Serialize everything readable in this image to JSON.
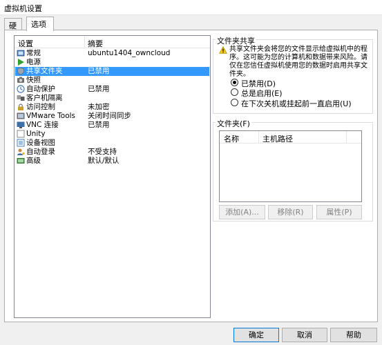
{
  "window": {
    "title": "虚拟机设置"
  },
  "tabs": [
    {
      "label": "硬件",
      "active": false
    },
    {
      "label": "选项",
      "active": true
    }
  ],
  "settings_list": {
    "headers": {
      "setting": "设置",
      "summary": "摘要"
    },
    "rows": [
      {
        "name": "常规",
        "value": "ubuntu1404_owncloud",
        "icon": "general-icon",
        "selected": false
      },
      {
        "name": "电源",
        "value": "",
        "icon": "power-play-icon",
        "selected": false
      },
      {
        "name": "共享文件夹",
        "value": "已禁用",
        "icon": "shared-folder-icon",
        "selected": true
      },
      {
        "name": "快照",
        "value": "",
        "icon": "snapshot-icon",
        "selected": false
      },
      {
        "name": "自动保护",
        "value": "已禁用",
        "icon": "autoprotect-icon",
        "selected": false
      },
      {
        "name": "客户机隔离",
        "value": "",
        "icon": "guest-isolation-icon",
        "selected": false
      },
      {
        "name": "访问控制",
        "value": "未加密",
        "icon": "access-control-icon",
        "selected": false
      },
      {
        "name": "VMware Tools",
        "value": "关闭时间同步",
        "icon": "vmware-tools-icon",
        "selected": false
      },
      {
        "name": "VNC 连接",
        "value": "已禁用",
        "icon": "vnc-icon",
        "selected": false
      },
      {
        "name": "Unity",
        "value": "",
        "icon": "unity-icon",
        "selected": false
      },
      {
        "name": "设备视图",
        "value": "",
        "icon": "device-view-icon",
        "selected": false
      },
      {
        "name": "自动登录",
        "value": "不受支持",
        "icon": "autologin-icon",
        "selected": false
      },
      {
        "name": "高级",
        "value": "默认/默认",
        "icon": "advanced-icon",
        "selected": false
      }
    ]
  },
  "folder_sharing": {
    "label": "文件夹共享",
    "warning": "共享文件夹会将您的文件显示给虚拟机中的程序。这可能为您的计算机和数据带来风险。请仅在您信任虚拟机使用您的数据时启用共享文件夹。",
    "options": [
      {
        "label": "已禁用(D)",
        "checked": true
      },
      {
        "label": "总是启用(E)",
        "checked": false
      },
      {
        "label": "在下次关机或挂起前一直启用(U)",
        "checked": false
      }
    ]
  },
  "folders": {
    "label": "文件夹(F)",
    "columns": [
      "名称",
      "主机路径"
    ],
    "buttons": {
      "add": "添加(A)...",
      "remove": "移除(R)",
      "properties": "属性(P)"
    }
  },
  "footer": {
    "ok": "确定",
    "cancel": "取消",
    "help": "帮助"
  }
}
